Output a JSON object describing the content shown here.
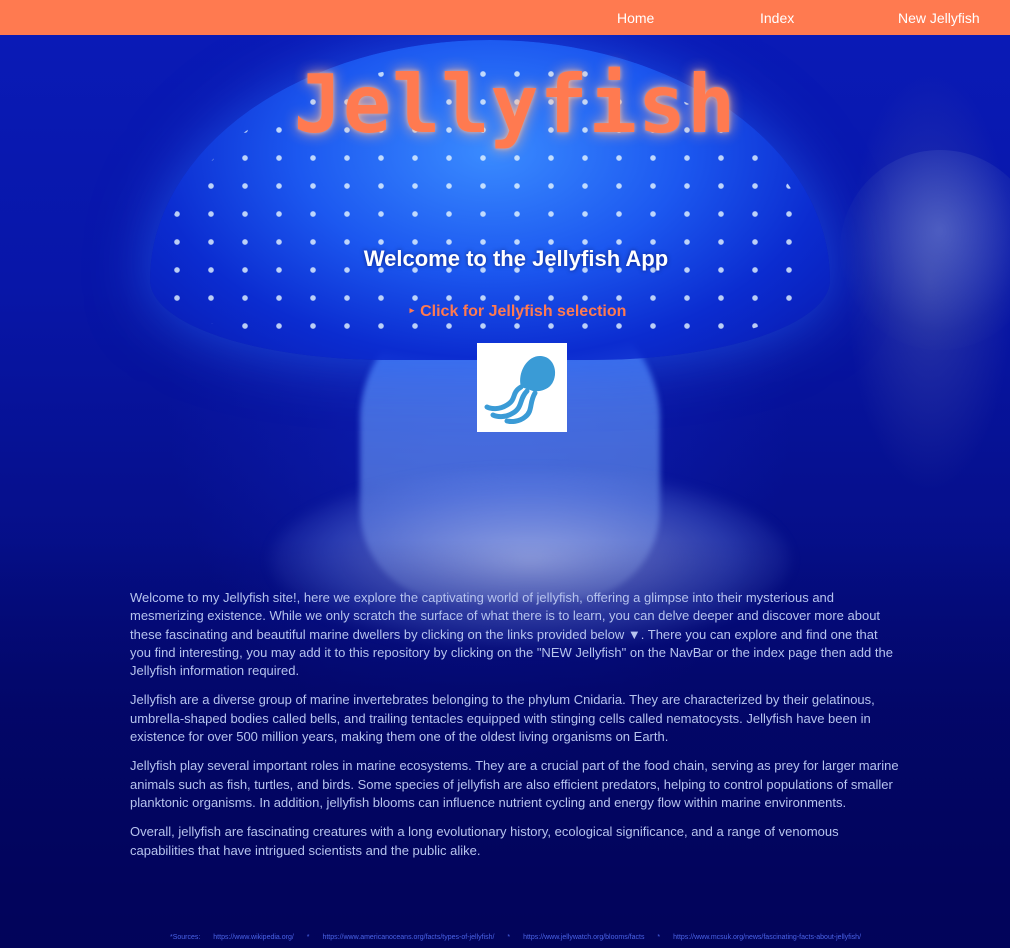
{
  "nav": {
    "home": "Home",
    "index": "Index",
    "new_jellyfish": "New Jellyfish"
  },
  "hero": {
    "title": "Jellyfish",
    "welcome": "Welcome to the Jellyfish App",
    "details_label": "Click for Jellyfish selection",
    "details_marker": "▸",
    "logo_icon": "jellyfish-icon"
  },
  "intro": {
    "paragraphs": [
      "Welcome to my Jellyfish site!, here we explore the captivating world of jellyfish, offering a glimpse into their mysterious and mesmerizing existence. While we only scratch the surface of what there is to learn, you can delve deeper and discover more about these fascinating and beautiful marine dwellers by clicking on the links provided below ▼. There you can explore and find one that you find interesting, you may add it to this repository by clicking on the \"NEW Jellyfish\" on the NavBar or the index page then add the Jellyfish information required.",
      "Jellyfish are a diverse group of marine invertebrates belonging to the phylum Cnidaria. They are characterized by their gelatinous, umbrella-shaped bodies called bells, and trailing tentacles equipped with stinging cells called nematocysts. Jellyfish have been in existence for over 500 million years, making them one of the oldest living organisms on Earth.",
      "Jellyfish play several important roles in marine ecosystems. They are a crucial part of the food chain, serving as prey for larger marine animals such as fish, turtles, and birds. Some species of jellyfish are also efficient predators, helping to control populations of smaller planktonic organisms. In addition, jellyfish blooms can influence nutrient cycling and energy flow within marine environments.",
      "Overall, jellyfish are fascinating creatures with a long evolutionary history, ecological significance, and a range of venomous capabilities that have intrigued scientists and the public alike."
    ]
  },
  "sources": {
    "label": "*Sources:",
    "separator": "*",
    "links": [
      "https://www.wikipedia.org/",
      "https://www.americanoceans.org/facts/types-of-jellyfish/",
      "https://www.jellywatch.org/blooms/facts",
      "https://www.mcsuk.org/news/fascinating-facts-about-jellyfish/"
    ]
  },
  "colors": {
    "accent": "#ff7a50",
    "background": "#02046a",
    "body_text": "#b6c3ee",
    "source_link": "#4a63e6",
    "logo_icon": "#3a9bd6"
  }
}
